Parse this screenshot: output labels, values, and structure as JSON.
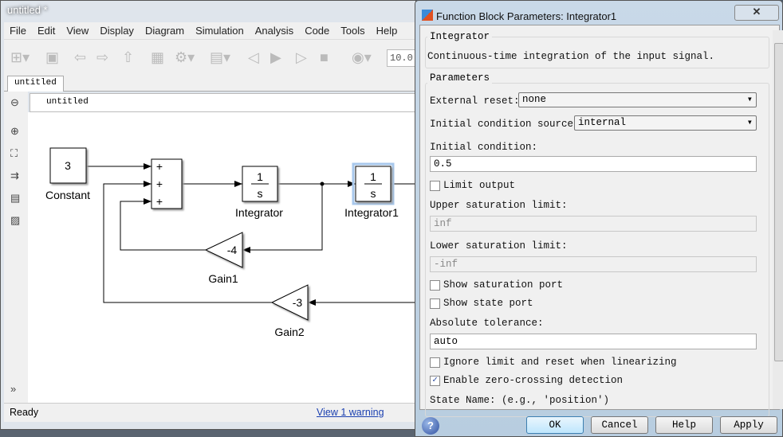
{
  "main": {
    "title": "untitled *",
    "menu": [
      "File",
      "Edit",
      "View",
      "Display",
      "Diagram",
      "Simulation",
      "Analysis",
      "Code",
      "Tools",
      "Help"
    ],
    "stop_time": "10.0",
    "tab": "untitled",
    "breadcrumb": "untitled",
    "status": "Ready",
    "warning_link": "View 1 warning"
  },
  "diagram": {
    "constant": {
      "value": "3",
      "label": "Constant"
    },
    "sum_signs": [
      "+",
      "+",
      "+"
    ],
    "integrator": {
      "num": "1",
      "den": "s",
      "label": "Integrator"
    },
    "integrator1": {
      "num": "1",
      "den": "s",
      "label": "Integrator1"
    },
    "gain1": {
      "value": "-4",
      "label": "Gain1"
    },
    "gain2": {
      "value": "-3",
      "label": "Gain2"
    }
  },
  "dialog": {
    "title": "Function Block Parameters: Integrator1",
    "group1": "Integrator",
    "description": "Continuous-time integration of the input signal.",
    "group2": "Parameters",
    "external_reset_label": "External reset:",
    "external_reset": "none",
    "ic_source_label": "Initial condition source:",
    "ic_source": "internal",
    "ic_label": "Initial condition:",
    "ic": "0.5",
    "limit_output": "Limit output",
    "limit_output_checked": false,
    "upper_label": "Upper saturation limit:",
    "upper": "inf",
    "lower_label": "Lower saturation limit:",
    "lower": "-inf",
    "show_sat": "Show saturation port",
    "show_state": "Show state port",
    "abstol_label": "Absolute tolerance:",
    "abstol": "auto",
    "ignore_limit": "Ignore limit and reset when linearizing",
    "zero_cross": "Enable zero-crossing detection",
    "zero_cross_checked": true,
    "state_name_label": "State Name: (e.g., 'position')",
    "buttons": {
      "ok": "OK",
      "cancel": "Cancel",
      "help": "Help",
      "apply": "Apply"
    }
  },
  "colors": {
    "highlight": "#a8c8ec",
    "dialog_title": "#c9d9e8"
  }
}
